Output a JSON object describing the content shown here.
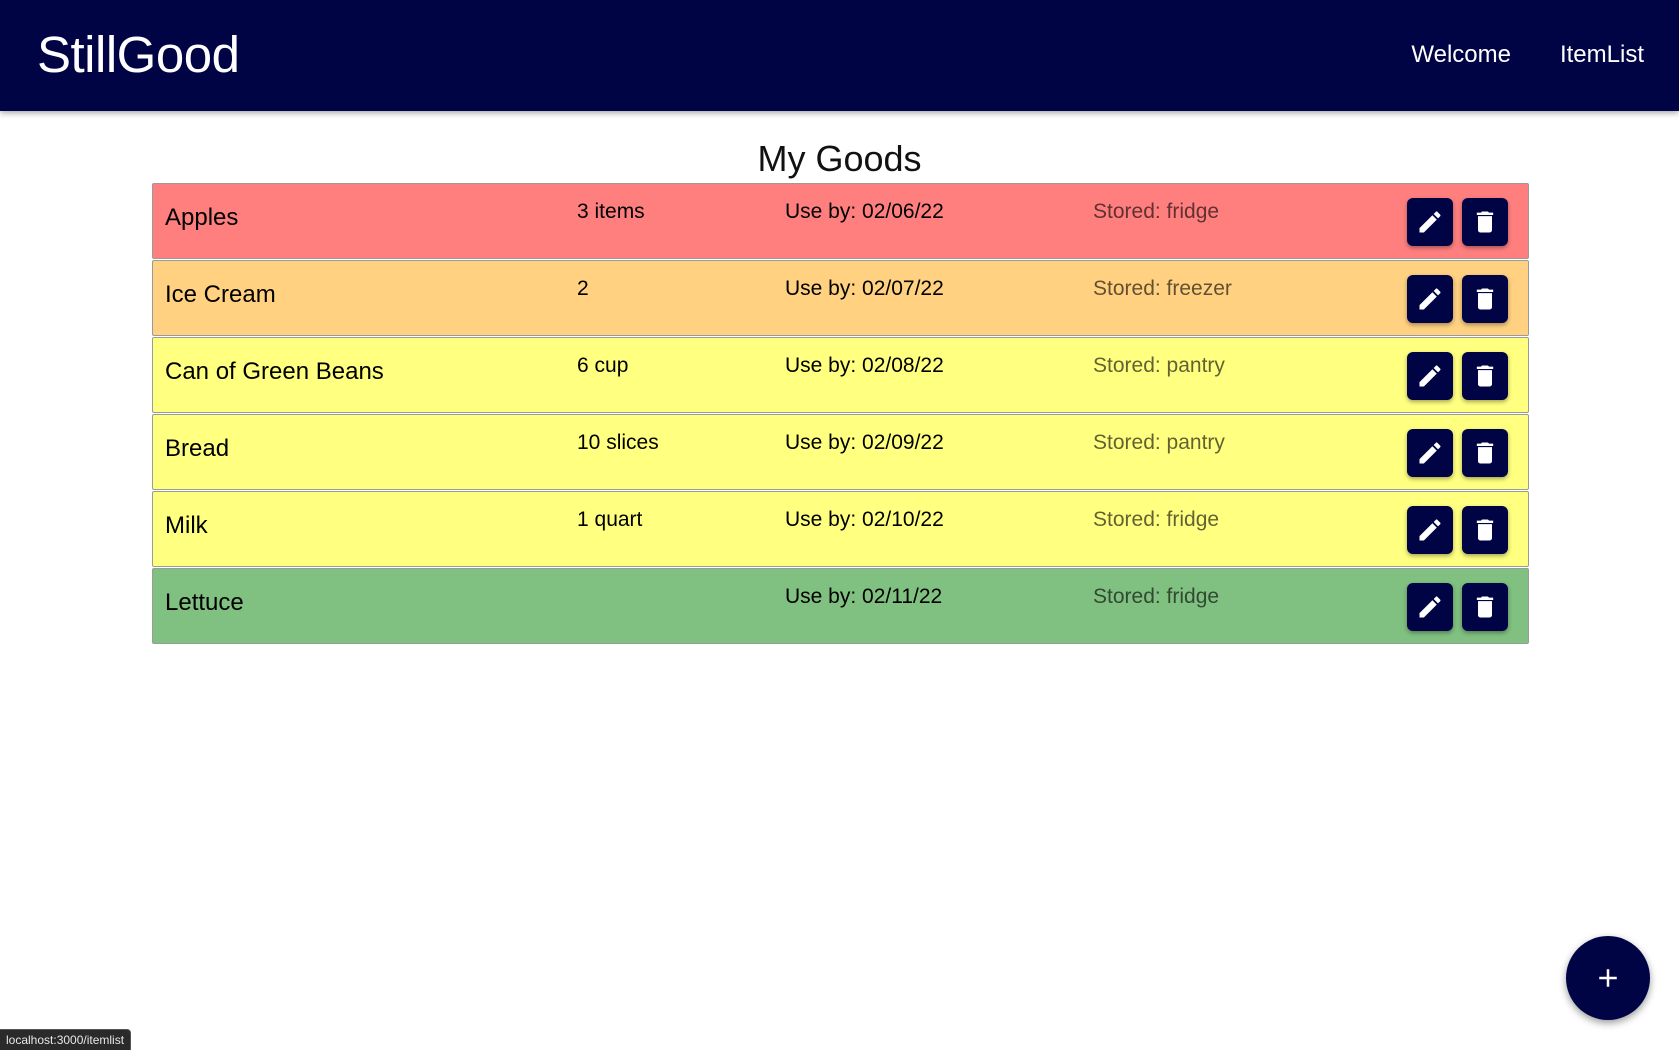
{
  "header": {
    "brand": "StillGood",
    "nav": [
      {
        "label": "Welcome"
      },
      {
        "label": "ItemList"
      }
    ],
    "background": "#000445"
  },
  "page_title": "My Goods",
  "items": [
    {
      "name": "Apples",
      "quantity": "3 items",
      "use_by": "Use by: 02/06/22",
      "stored": "Stored: fridge",
      "color": "#ff7f7f"
    },
    {
      "name": "Ice Cream",
      "quantity": "2",
      "use_by": "Use by: 02/07/22",
      "stored": "Stored: freezer",
      "color": "#ffd180"
    },
    {
      "name": "Can of Green Beans",
      "quantity": "6 cup",
      "use_by": "Use by: 02/08/22",
      "stored": "Stored: pantry",
      "color": "#ffff80"
    },
    {
      "name": "Bread",
      "quantity": "10 slices",
      "use_by": "Use by: 02/09/22",
      "stored": "Stored: pantry",
      "color": "#ffff80"
    },
    {
      "name": "Milk",
      "quantity": "1 quart",
      "use_by": "Use by: 02/10/22",
      "stored": "Stored: fridge",
      "color": "#ffff80"
    },
    {
      "name": "Lettuce",
      "quantity": "",
      "use_by": "Use by: 02/11/22",
      "stored": "Stored: fridge",
      "color": "#80c080"
    }
  ],
  "icons": {
    "edit": "pencil-icon",
    "delete": "trash-icon",
    "add": "plus-icon"
  },
  "status_bar": {
    "url": "localhost:3000/itemlist"
  }
}
